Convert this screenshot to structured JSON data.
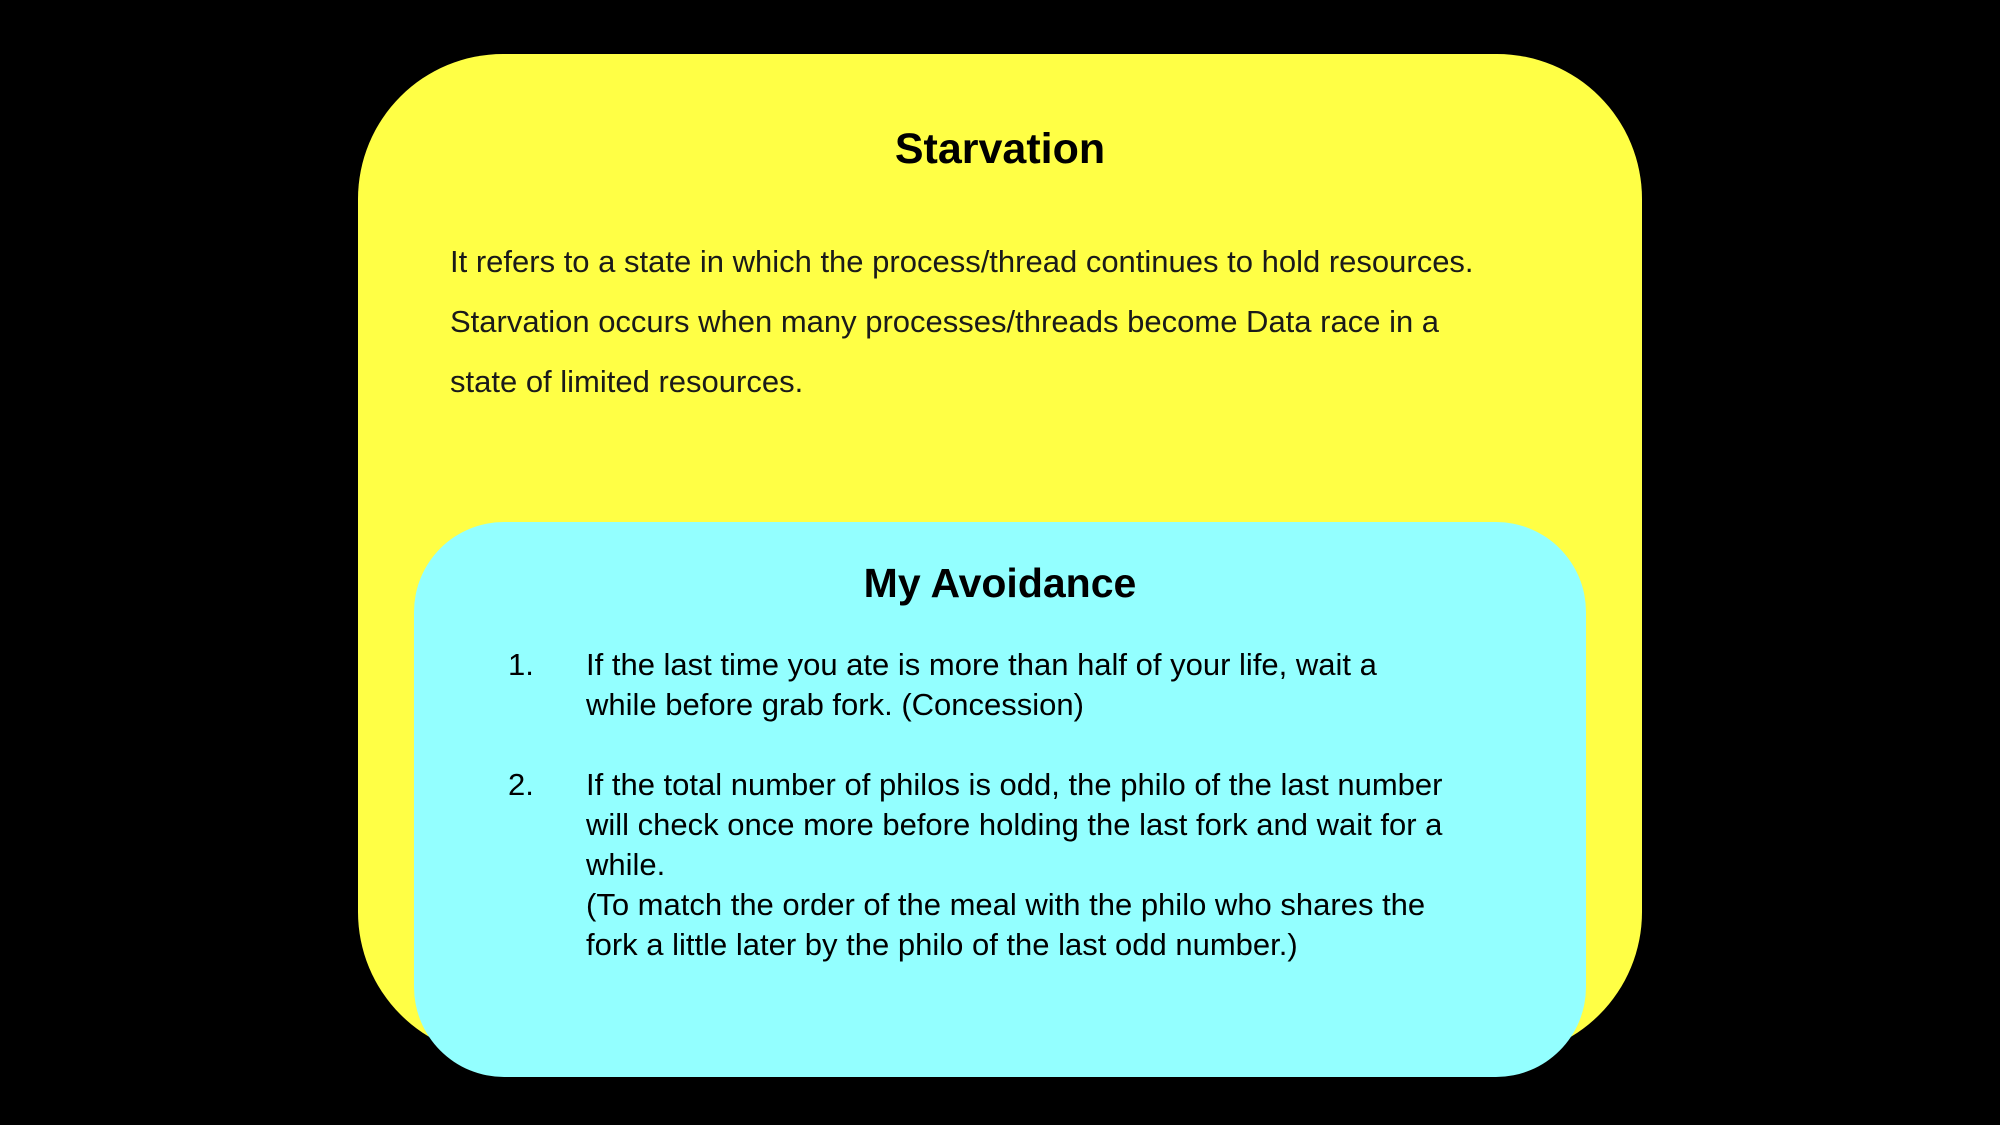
{
  "starvation": {
    "title": "Starvation",
    "description_lines": [
      "It refers to a state in which the process/thread continues to hold resources.",
      "Starvation occurs when many processes/threads become Data race in a",
      "state of limited resources."
    ]
  },
  "avoidance": {
    "title": "My Avoidance",
    "items": [
      {
        "number": "1.",
        "lines": [
          "If the last time you ate is more than half of your life, wait a",
          "while before grab fork. (Concession)"
        ]
      },
      {
        "number": "2.",
        "lines": [
          "If the total number of philos is odd, the philo of the last number",
          "will check once more before holding the last fork and wait for a",
          "while.",
          "(To match the order of the meal with the philo who shares the",
          "fork a little later by the philo of the last odd number.)"
        ]
      }
    ]
  },
  "colors": {
    "background": "#000000",
    "outer_card": "#ffff45",
    "inner_card": "#93ffff"
  }
}
